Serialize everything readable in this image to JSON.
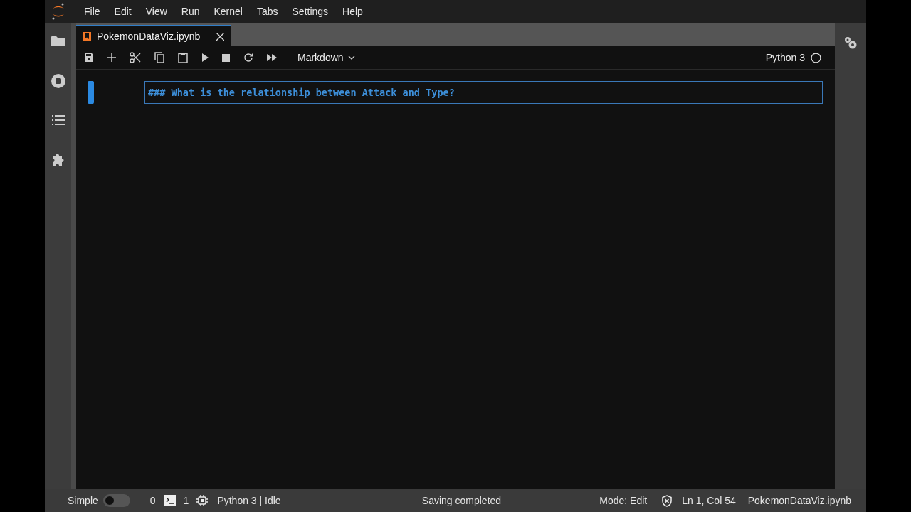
{
  "menu": [
    "File",
    "Edit",
    "View",
    "Run",
    "Kernel",
    "Tabs",
    "Settings",
    "Help"
  ],
  "tabs": [
    {
      "label": "PokemonDataViz.ipynb",
      "selected": true
    }
  ],
  "toolbar": {
    "cell_type": "Markdown",
    "kernel": "Python 3"
  },
  "cells": [
    {
      "kind": "markdown",
      "active": true,
      "source": "### What is the relationship between Attack and Type?"
    }
  ],
  "status_bar": {
    "mode_label": "Simple",
    "simple_mode": false,
    "terminals": "0",
    "kernels": "1",
    "kernel_status": "Python 3 | Idle",
    "message": "Saving completed",
    "mode": "Mode: Edit",
    "position": "Ln 1, Col 54",
    "file": "PokemonDataViz.ipynb"
  }
}
